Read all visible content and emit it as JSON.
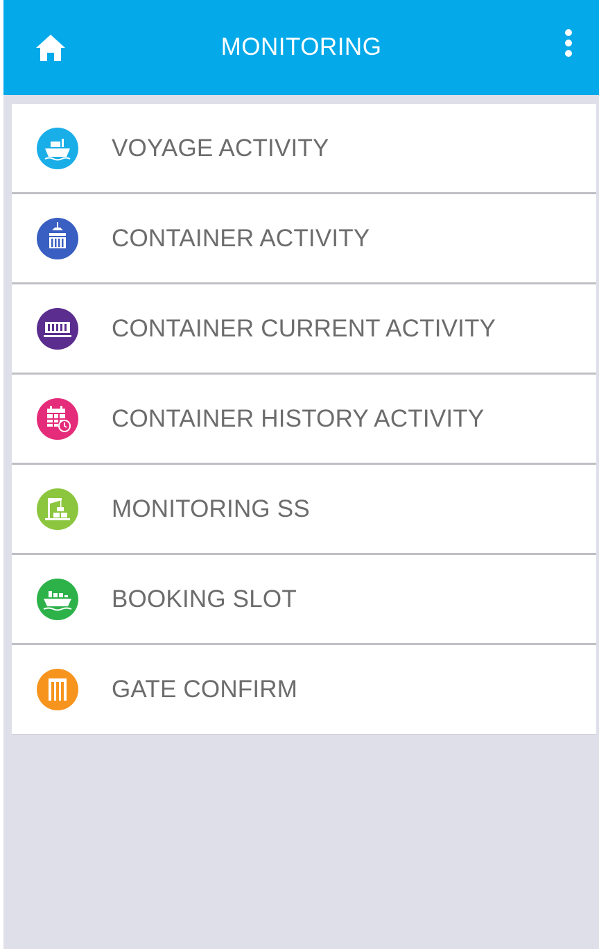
{
  "appbar": {
    "title": "MONITORING",
    "home_icon": "home-icon",
    "more_icon": "more-vert-icon",
    "color": "#03a9e9"
  },
  "menu": {
    "items": [
      {
        "label": "VOYAGE ACTIVITY",
        "icon": "ship-icon",
        "color": "#1aaee8"
      },
      {
        "label": "CONTAINER ACTIVITY",
        "icon": "container-crane-icon",
        "color": "#3a5fc2"
      },
      {
        "label": "CONTAINER CURRENT ACTIVITY",
        "icon": "container-icon",
        "color": "#5b2d8e"
      },
      {
        "label": "CONTAINER HISTORY ACTIVITY",
        "icon": "calendar-clock-icon",
        "color": "#e42c7a"
      },
      {
        "label": "MONITORING SS",
        "icon": "crane-icon",
        "color": "#8cc63f"
      },
      {
        "label": "BOOKING SLOT",
        "icon": "cargo-ship-icon",
        "color": "#2db24a"
      },
      {
        "label": "GATE CONFIRM",
        "icon": "gate-icon",
        "color": "#f7941d"
      }
    ]
  }
}
